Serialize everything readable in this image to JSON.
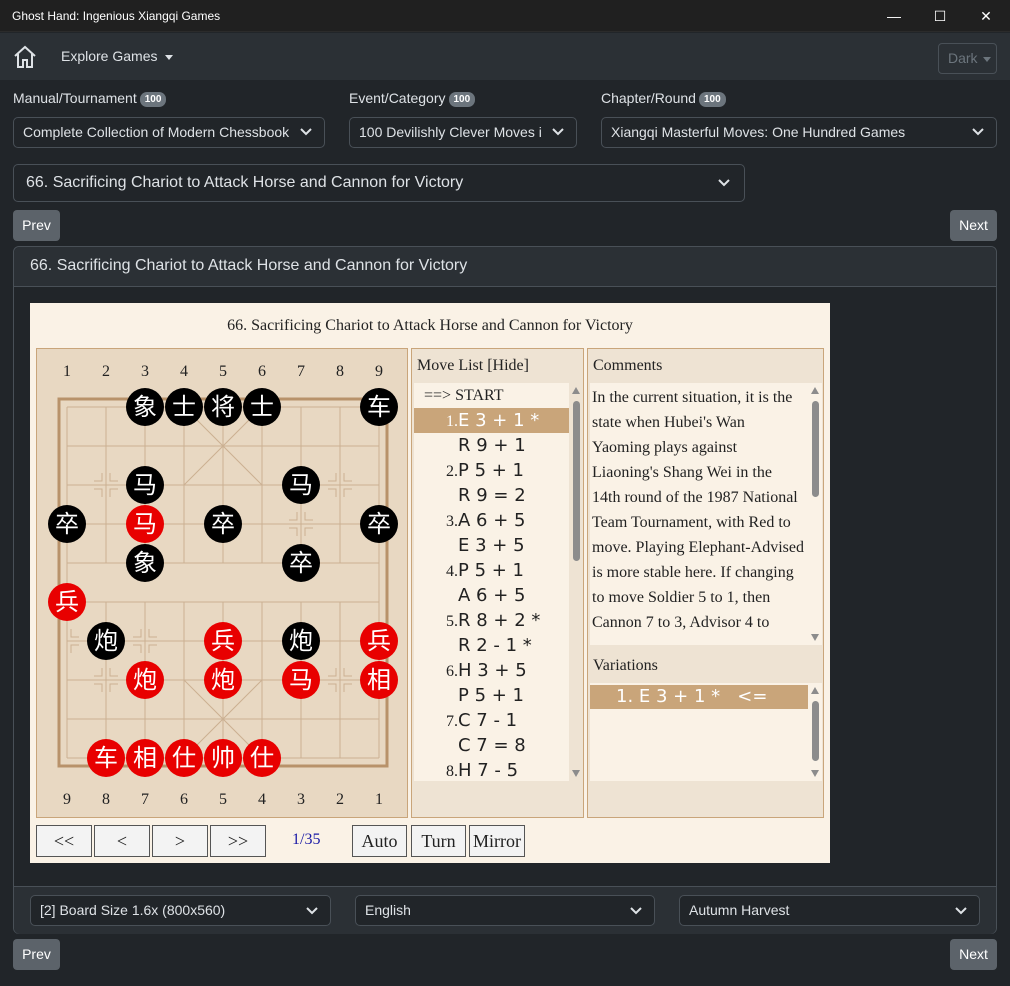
{
  "window": {
    "title": "Ghost Hand: Ingenious Xiangqi Games",
    "minimize": "—",
    "maximize": "☐",
    "close": "✕"
  },
  "navbar": {
    "home_icon": "home-icon",
    "explore_label": "Explore Games",
    "theme_label": "Dark"
  },
  "filters": [
    {
      "label": "Manual/Tournament",
      "count": "100",
      "value": "Complete Collection of Modern Chessbook"
    },
    {
      "label": "Event/Category",
      "count": "100",
      "value": "100 Devilishly Clever Moves i"
    },
    {
      "label": "Chapter/Round",
      "count": "100",
      "value": "Xiangqi Masterful Moves: One Hundred Games"
    }
  ],
  "game_select": "66. Sacrificing Chariot to Attack Horse and Cannon for Victory",
  "buttons": {
    "prev": "Prev",
    "next": "Next"
  },
  "card_title": "66. Sacrificing Chariot to Attack Horse and Cannon for Victory",
  "board": {
    "title": "66. Sacrificing Chariot to Attack Horse and Cannon for Victory",
    "top_files": [
      "1",
      "2",
      "3",
      "4",
      "5",
      "6",
      "7",
      "8",
      "9"
    ],
    "bottom_files": [
      "9",
      "8",
      "7",
      "6",
      "5",
      "4",
      "3",
      "2",
      "1"
    ],
    "pieces": [
      {
        "c": "black",
        "t": "象",
        "f": 2,
        "r": 0
      },
      {
        "c": "black",
        "t": "士",
        "f": 3,
        "r": 0
      },
      {
        "c": "black",
        "t": "将",
        "f": 4,
        "r": 0
      },
      {
        "c": "black",
        "t": "士",
        "f": 5,
        "r": 0
      },
      {
        "c": "black",
        "t": "车",
        "f": 8,
        "r": 0
      },
      {
        "c": "black",
        "t": "马",
        "f": 2,
        "r": 2
      },
      {
        "c": "black",
        "t": "马",
        "f": 6,
        "r": 2
      },
      {
        "c": "black",
        "t": "卒",
        "f": 0,
        "r": 3
      },
      {
        "c": "red",
        "t": "马",
        "f": 2,
        "r": 3
      },
      {
        "c": "black",
        "t": "卒",
        "f": 4,
        "r": 3
      },
      {
        "c": "black",
        "t": "卒",
        "f": 8,
        "r": 3
      },
      {
        "c": "black",
        "t": "象",
        "f": 2,
        "r": 4
      },
      {
        "c": "black",
        "t": "卒",
        "f": 6,
        "r": 4
      },
      {
        "c": "red",
        "t": "兵",
        "f": 0,
        "r": 5
      },
      {
        "c": "black",
        "t": "炮",
        "f": 1,
        "r": 6
      },
      {
        "c": "red",
        "t": "兵",
        "f": 4,
        "r": 6
      },
      {
        "c": "black",
        "t": "炮",
        "f": 6,
        "r": 6
      },
      {
        "c": "red",
        "t": "兵",
        "f": 8,
        "r": 6
      },
      {
        "c": "red",
        "t": "炮",
        "f": 2,
        "r": 7
      },
      {
        "c": "red",
        "t": "炮",
        "f": 4,
        "r": 7
      },
      {
        "c": "red",
        "t": "马",
        "f": 6,
        "r": 7
      },
      {
        "c": "red",
        "t": "相",
        "f": 8,
        "r": 7
      },
      {
        "c": "red",
        "t": "车",
        "f": 1,
        "r": 9
      },
      {
        "c": "red",
        "t": "相",
        "f": 2,
        "r": 9
      },
      {
        "c": "red",
        "t": "仕",
        "f": 3,
        "r": 9
      },
      {
        "c": "red",
        "t": "帅",
        "f": 4,
        "r": 9
      },
      {
        "c": "red",
        "t": "仕",
        "f": 5,
        "r": 9
      }
    ]
  },
  "move_list": {
    "header": "Move List [Hide]",
    "start": "==> START",
    "moves": [
      {
        "num": "1.",
        "text": "E 3 + 1 *",
        "selected": true
      },
      {
        "num": "",
        "text": "R 9 + 1",
        "selected": false
      },
      {
        "num": "2.",
        "text": "P 5 + 1",
        "selected": false
      },
      {
        "num": "",
        "text": "R 9 = 2",
        "selected": false
      },
      {
        "num": "3.",
        "text": "A 6 + 5",
        "selected": false
      },
      {
        "num": "",
        "text": "E 3 + 5",
        "selected": false
      },
      {
        "num": "4.",
        "text": "P 5 + 1",
        "selected": false
      },
      {
        "num": "",
        "text": "A 6 + 5",
        "selected": false
      },
      {
        "num": "5.",
        "text": "R 8 + 2 *",
        "selected": false
      },
      {
        "num": "",
        "text": "R 2 - 1 *",
        "selected": false
      },
      {
        "num": "6.",
        "text": "H 3 + 5",
        "selected": false
      },
      {
        "num": "",
        "text": "P 5 + 1",
        "selected": false
      },
      {
        "num": "7.",
        "text": "C 7 - 1",
        "selected": false
      },
      {
        "num": "",
        "text": "C 7 = 8",
        "selected": false
      },
      {
        "num": "8.",
        "text": "H 7 - 5",
        "selected": false
      }
    ]
  },
  "comments": {
    "header": "Comments",
    "text": "In the current situation, it is the state when Hubei's Wan Yaoming plays against Liaoning's Shang Wei in the 14th round of the 1987 National Team Tournament, with Red to move. Playing Elephant-Advised is more stable here. If changing to move Soldier 5 to 1, then Cannon 7 to 3, Advisor 4 to"
  },
  "variations": {
    "header": "Variations",
    "selected": "1. E 3 + 1 *   <="
  },
  "controls": {
    "first": "<<",
    "prev": "<",
    "next": ">",
    "last": ">>",
    "counter": "1/35",
    "auto": "Auto",
    "turn": "Turn",
    "mirror": "Mirror"
  },
  "footer_selects": {
    "board_size": "[2] Board Size 1.6x (800x560)",
    "language": "English",
    "theme": "Autumn Harvest"
  },
  "colors": {
    "background": "#212529",
    "navbar": "#2b3035",
    "board_bg": "#e8d8c2",
    "selected_move": "#c9a57a",
    "red_piece": "#e80000",
    "black_piece": "#000000"
  }
}
